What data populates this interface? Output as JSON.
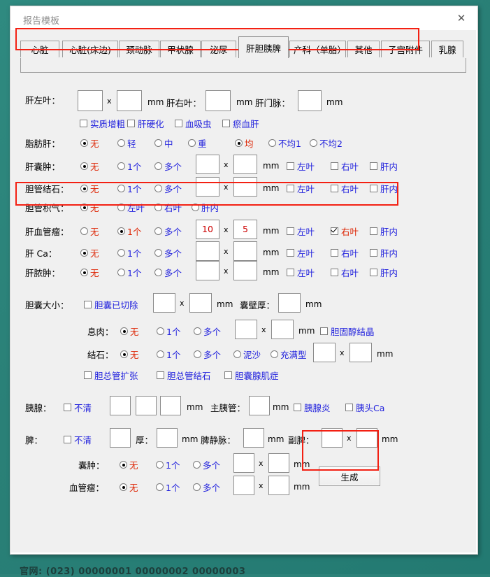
{
  "window": {
    "title": "报告模板",
    "close_icon": "close-icon"
  },
  "desktop": {
    "footer_text": "官网: (023) 00000001 00000002 00000003"
  },
  "tabs": [
    {
      "label": "心脏",
      "selected": false
    },
    {
      "label": "心脏(床边)",
      "selected": false
    },
    {
      "label": "颈动脉",
      "selected": false
    },
    {
      "label": "甲状腺",
      "selected": false
    },
    {
      "label": "泌尿",
      "selected": false
    },
    {
      "label": "肝胆胰脾",
      "selected": true
    },
    {
      "label": "产科（单胎）",
      "selected": false
    },
    {
      "label": "其他",
      "selected": false
    },
    {
      "label": "子宫附件",
      "selected": false
    },
    {
      "label": "乳腺",
      "selected": false
    }
  ],
  "labels": {
    "liver_left": "肝左叶：",
    "liver_right": "肝右叶：",
    "portal_vein": "肝门脉：",
    "mm": "mm",
    "x": "x",
    "fatty_liver": "脂肪肝：",
    "liver_cyst": "肝囊肿：",
    "bile_duct_stone": "胆管结石：",
    "bile_duct_gas": "胆管积气：",
    "liver_hemangioma": "肝血管瘤：",
    "liver_ca": "肝 Ca：",
    "liver_abscess": "肝脓肿：",
    "gb_size": "胆囊大小：",
    "gb_wall": "囊壁厚：",
    "polyp": "息肉：",
    "stone": "结石：",
    "pancreas": "胰腺：",
    "main_duct": "主胰管：",
    "spleen": "脾：",
    "thick": "厚：",
    "splenic_vein": "脾静脉：",
    "accessory_spleen": "副脾：",
    "cyst2": "囊肿：",
    "hemangioma2": "血管瘤："
  },
  "options": {
    "none": "无",
    "one": "1个",
    "many": "多个",
    "mild": "轻",
    "moderate": "中",
    "severe": "重",
    "even": "均",
    "uneven1": "不均1",
    "uneven2": "不均2",
    "left_lobe": "左叶",
    "right_lobe": "右叶",
    "intrahepatic": "肝内",
    "sludge": "泥沙",
    "full_type": "充满型",
    "unclear": "不清"
  },
  "checkboxes": {
    "parenchyma_coarse": "实质增粗",
    "cirrhosis": "肝硬化",
    "schistosome": "血吸虫",
    "congestive_liver": "瘀血肝",
    "gb_removed": "胆囊已切除",
    "cholesterol_crystal": "胆固醇结晶",
    "cbd_dilation": "胆总管扩张",
    "cbd_stone": "胆总管结石",
    "adenomyomatosis": "胆囊腺肌症",
    "pancreatitis": "胰腺炎",
    "pancreas_head_ca": "胰头Ca"
  },
  "values": {
    "hemangioma_size1": "10",
    "hemangioma_size2": "5"
  },
  "buttons": {
    "generate": "生成"
  },
  "selection": {
    "fatty_liver_degree": "无",
    "fatty_liver_uniformity": "均",
    "liver_cyst": "无",
    "bile_duct_stone": "无",
    "bile_duct_gas": "无",
    "liver_hemangioma": "1个",
    "liver_hemangioma_lobe": "右叶",
    "liver_ca": "无",
    "liver_abscess": "无",
    "polyp": "无",
    "stone": "无",
    "spleen_cyst": "无",
    "spleen_hemangioma": "无"
  },
  "colors": {
    "desktop": "#2d8279",
    "highlight": "#f32013",
    "label_blue": "#2222dd",
    "label_red": "#dd2200",
    "value_red": "#cc0000"
  }
}
